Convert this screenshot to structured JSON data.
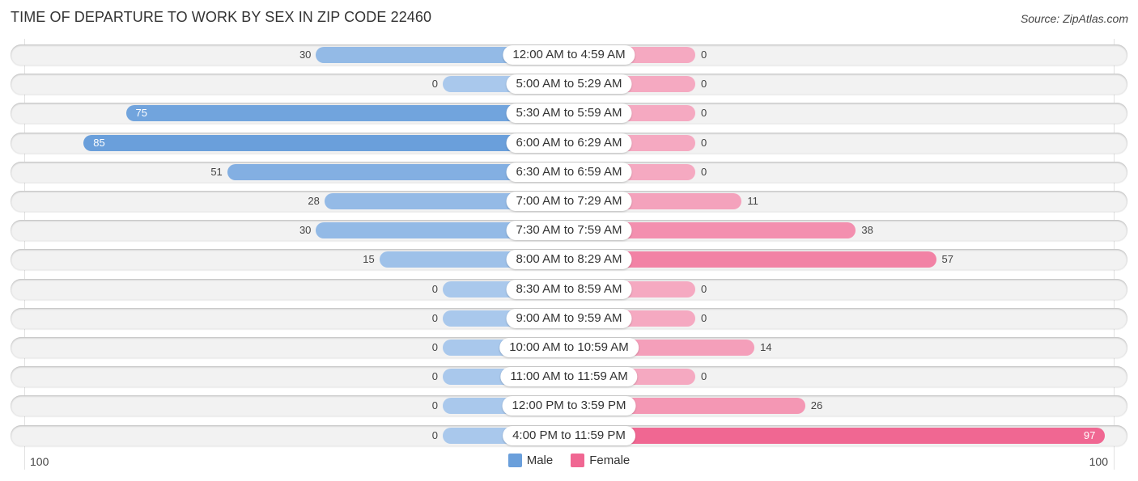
{
  "header": {
    "title": "TIME OF DEPARTURE TO WORK BY SEX IN ZIP CODE 22460",
    "source": "Source: ZipAtlas.com"
  },
  "colors": {
    "male": "#6a9fdb",
    "male_light": "#a9c8ec",
    "female": "#f06792",
    "female_light": "#f5a9c1",
    "row_bg": "#f2f2f2"
  },
  "chart_data": {
    "type": "bar",
    "orientation": "horizontal-diverging",
    "title": "TIME OF DEPARTURE TO WORK BY SEX IN ZIP CODE 22460",
    "categories": [
      "12:00 AM to 4:59 AM",
      "5:00 AM to 5:29 AM",
      "5:30 AM to 5:59 AM",
      "6:00 AM to 6:29 AM",
      "6:30 AM to 6:59 AM",
      "7:00 AM to 7:29 AM",
      "7:30 AM to 7:59 AM",
      "8:00 AM to 8:29 AM",
      "8:30 AM to 8:59 AM",
      "9:00 AM to 9:59 AM",
      "10:00 AM to 10:59 AM",
      "11:00 AM to 11:59 AM",
      "12:00 PM to 3:59 PM",
      "4:00 PM to 11:59 PM"
    ],
    "series": [
      {
        "name": "Male",
        "values": [
          30,
          0,
          75,
          85,
          51,
          28,
          30,
          15,
          0,
          0,
          0,
          0,
          0,
          0
        ]
      },
      {
        "name": "Female",
        "values": [
          0,
          0,
          0,
          0,
          0,
          11,
          38,
          57,
          0,
          0,
          14,
          0,
          26,
          97
        ]
      }
    ],
    "axis": {
      "left_label": "100",
      "right_label": "100",
      "max": 100
    },
    "legend": {
      "position": "bottom-center",
      "entries": [
        "Male",
        "Female"
      ]
    },
    "grid": false
  }
}
